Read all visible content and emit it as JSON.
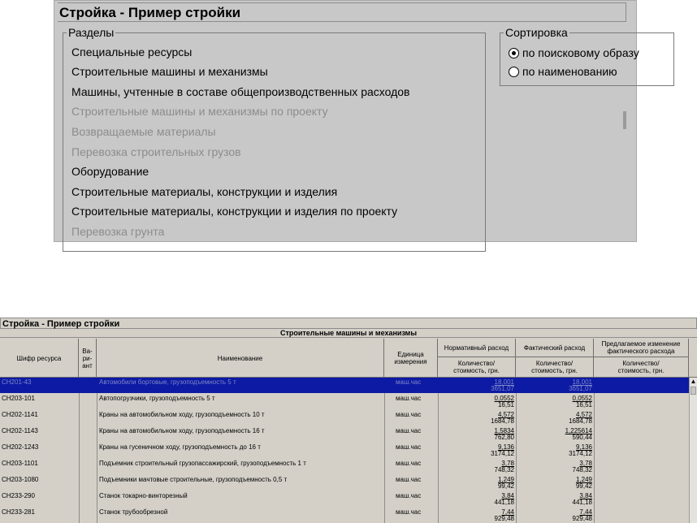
{
  "top": {
    "title": "Стройка - Пример стройки",
    "sections_label": "Разделы",
    "sections": [
      {
        "label": "Специальные ресурсы",
        "enabled": true
      },
      {
        "label": "Строительные машины и механизмы",
        "enabled": true
      },
      {
        "label": "Машины, учтенные в составе общепроизводственных расходов",
        "enabled": true
      },
      {
        "label": "Строительные машины и механизмы по проекту",
        "enabled": false
      },
      {
        "label": "Возвращаемые материалы",
        "enabled": false
      },
      {
        "label": "Перевозка строительных грузов",
        "enabled": false
      },
      {
        "label": "Оборудование",
        "enabled": true
      },
      {
        "label": "Строительные материалы, конструкции и изделия",
        "enabled": true
      },
      {
        "label": "Строительные материалы, конструкции и изделия по проекту",
        "enabled": true
      },
      {
        "label": "Перевозка грунта",
        "enabled": false
      }
    ],
    "sort_label": "Сортировка",
    "sort_options": [
      {
        "label": "по поисковому образу",
        "checked": true
      },
      {
        "label": "по наименованию",
        "checked": false
      }
    ]
  },
  "bottom": {
    "title": "Стройка - Пример стройки",
    "caption": "Строительные машины и механизмы",
    "headers": {
      "code": "Шифр ресурса",
      "variant": "Ва-\nри-\nант",
      "name": "Наименование",
      "unit": "Единица\nизмерения",
      "norm": "Нормативный расход",
      "norm_sub": "Количество/\nстоимость, грн.",
      "fact": "Фактический расход",
      "fact_sub": "Количество/\nстоимость, грн.",
      "proposed": "Предлагаемое изменение\nфактического расхода",
      "proposed_sub": "Количество/\nстоимость, грн."
    },
    "rows": [
      {
        "code": "СН201-43",
        "name": "Автомобили бортовые, грузоподъемность 5 т",
        "unit": "маш.час",
        "norm_qty": "18,001",
        "norm_cost": "3651,07",
        "fact_qty": "18,001",
        "fact_cost": "3651,07",
        "selected": true
      },
      {
        "code": "СН203-101",
        "name": "Автопогрузчики, грузоподъемность 5 т",
        "unit": "маш.час",
        "norm_qty": "0,0552",
        "norm_cost": "16,51",
        "fact_qty": "0,0552",
        "fact_cost": "16,51",
        "selected": false
      },
      {
        "code": "СН202-1141",
        "name": "Краны на автомобильном ходу, грузоподъемность 10 т",
        "unit": "маш.час",
        "norm_qty": "4,572",
        "norm_cost": "1684,78",
        "fact_qty": "4,572",
        "fact_cost": "1684,78",
        "selected": false
      },
      {
        "code": "СН202-1143",
        "name": "Краны на автомобильном ходу, грузоподъемность 16 т",
        "unit": "маш.час",
        "norm_qty": "1,5834",
        "norm_cost": "762,80",
        "fact_qty": "1,225614",
        "fact_cost": "590,44",
        "selected": false
      },
      {
        "code": "СН202-1243",
        "name": "Краны на гусеничном ходу, грузоподъемность до 16 т",
        "unit": "маш.час",
        "norm_qty": "9,136",
        "norm_cost": "3174,12",
        "fact_qty": "9,136",
        "fact_cost": "3174,12",
        "selected": false
      },
      {
        "code": "СН203-1101",
        "name": "Подъемник строительный грузопассажирский, грузоподъемность 1 т",
        "unit": "маш.час",
        "norm_qty": "3,78",
        "norm_cost": "748,32",
        "fact_qty": "3,78",
        "fact_cost": "748,32",
        "selected": false
      },
      {
        "code": "СН203-1080",
        "name": "Подъемники мачтовые строительные, грузоподъемность 0,5 т",
        "unit": "маш.час",
        "norm_qty": "1,249",
        "norm_cost": "99,42",
        "fact_qty": "1,249",
        "fact_cost": "99,42",
        "selected": false
      },
      {
        "code": "СН233-290",
        "name": "Станок токарно-винторезный",
        "unit": "маш.час",
        "norm_qty": "3,84",
        "norm_cost": "441,18",
        "fact_qty": "3,84",
        "fact_cost": "441,18",
        "selected": false
      },
      {
        "code": "СН233-281",
        "name": "Станок трубообрезной",
        "unit": "маш.час",
        "norm_qty": "7,44",
        "norm_cost": "929,48",
        "fact_qty": "7,44",
        "fact_cost": "929,48",
        "selected": false
      }
    ],
    "scroll_up_icon": "▲"
  }
}
